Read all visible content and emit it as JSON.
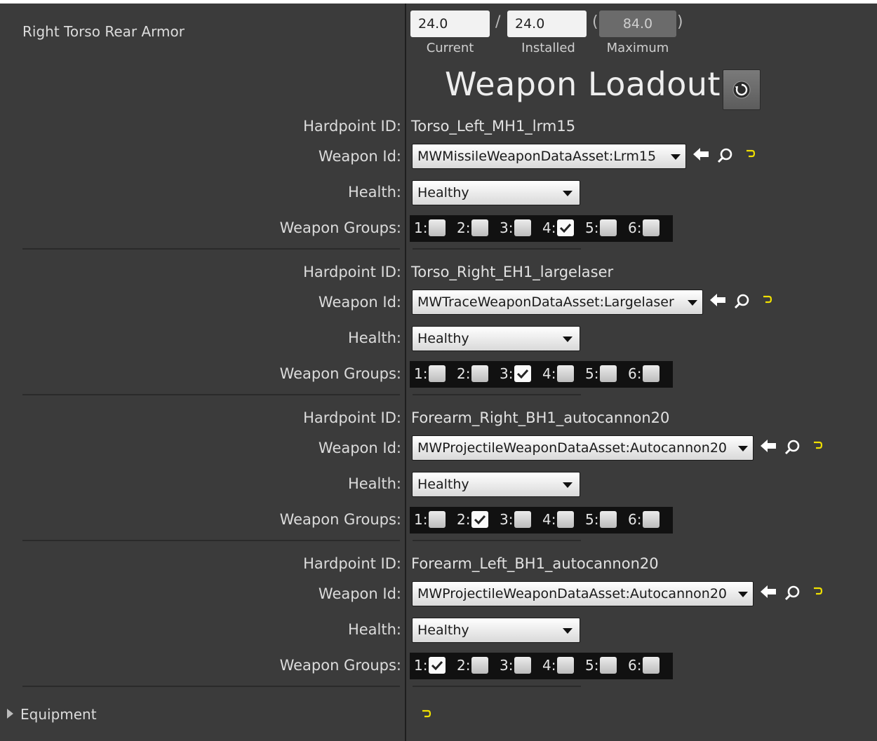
{
  "armor": {
    "label": "Right Torso Rear Armor",
    "current_value": "24.0",
    "installed_value": "24.0",
    "maximum_value": "84.0",
    "separator": "/",
    "open_paren": "(",
    "close_paren": ")",
    "captions": {
      "current": "Current",
      "installed": "Installed",
      "maximum": "Maximum"
    }
  },
  "section": {
    "title": "Weapon Loadout",
    "reset_icon": "reset-icon"
  },
  "labels": {
    "hardpoint_id": "Hardpoint ID:",
    "weapon_id": "Weapon Id:",
    "health": "Health:",
    "weapon_groups": "Weapon Groups:"
  },
  "hardpoints": [
    {
      "hardpoint_id": "Torso_Left_MH1_lrm15",
      "weapon_id": "MWMissileWeaponDataAsset:Lrm15",
      "health": "Healthy",
      "groups": [
        {
          "label": "1:",
          "checked": false
        },
        {
          "label": "2:",
          "checked": false
        },
        {
          "label": "3:",
          "checked": false
        },
        {
          "label": "4:",
          "checked": true
        },
        {
          "label": "5:",
          "checked": false
        },
        {
          "label": "6:",
          "checked": false
        }
      ]
    },
    {
      "hardpoint_id": "Torso_Right_EH1_largelaser",
      "weapon_id": "MWTraceWeaponDataAsset:Largelaser",
      "health": "Healthy",
      "groups": [
        {
          "label": "1:",
          "checked": false
        },
        {
          "label": "2:",
          "checked": false
        },
        {
          "label": "3:",
          "checked": true
        },
        {
          "label": "4:",
          "checked": false
        },
        {
          "label": "5:",
          "checked": false
        },
        {
          "label": "6:",
          "checked": false
        }
      ]
    },
    {
      "hardpoint_id": "Forearm_Right_BH1_autocannon20",
      "weapon_id": "MWProjectileWeaponDataAsset:Autocannon20",
      "health": "Healthy",
      "groups": [
        {
          "label": "1:",
          "checked": false
        },
        {
          "label": "2:",
          "checked": true
        },
        {
          "label": "3:",
          "checked": false
        },
        {
          "label": "4:",
          "checked": false
        },
        {
          "label": "5:",
          "checked": false
        },
        {
          "label": "6:",
          "checked": false
        }
      ]
    },
    {
      "hardpoint_id": "Forearm_Left_BH1_autocannon20",
      "weapon_id": "MWProjectileWeaponDataAsset:Autocannon20",
      "health": "Healthy",
      "groups": [
        {
          "label": "1:",
          "checked": true
        },
        {
          "label": "2:",
          "checked": false
        },
        {
          "label": "3:",
          "checked": false
        },
        {
          "label": "4:",
          "checked": false
        },
        {
          "label": "5:",
          "checked": false
        },
        {
          "label": "6:",
          "checked": false
        }
      ]
    }
  ],
  "equipment": {
    "label": "Equipment"
  },
  "icons": {
    "use_selected": "arrow-left-icon",
    "browse": "search-icon",
    "reset_default": "undo-icon",
    "dropdown": "chevron-down-icon",
    "expand": "triangle-right-icon"
  },
  "colors": {
    "background": "#3b3b3b",
    "text": "#dcdcdc",
    "reset_arrow": "#f0e000",
    "panel_divider": "#1e1e1e"
  }
}
